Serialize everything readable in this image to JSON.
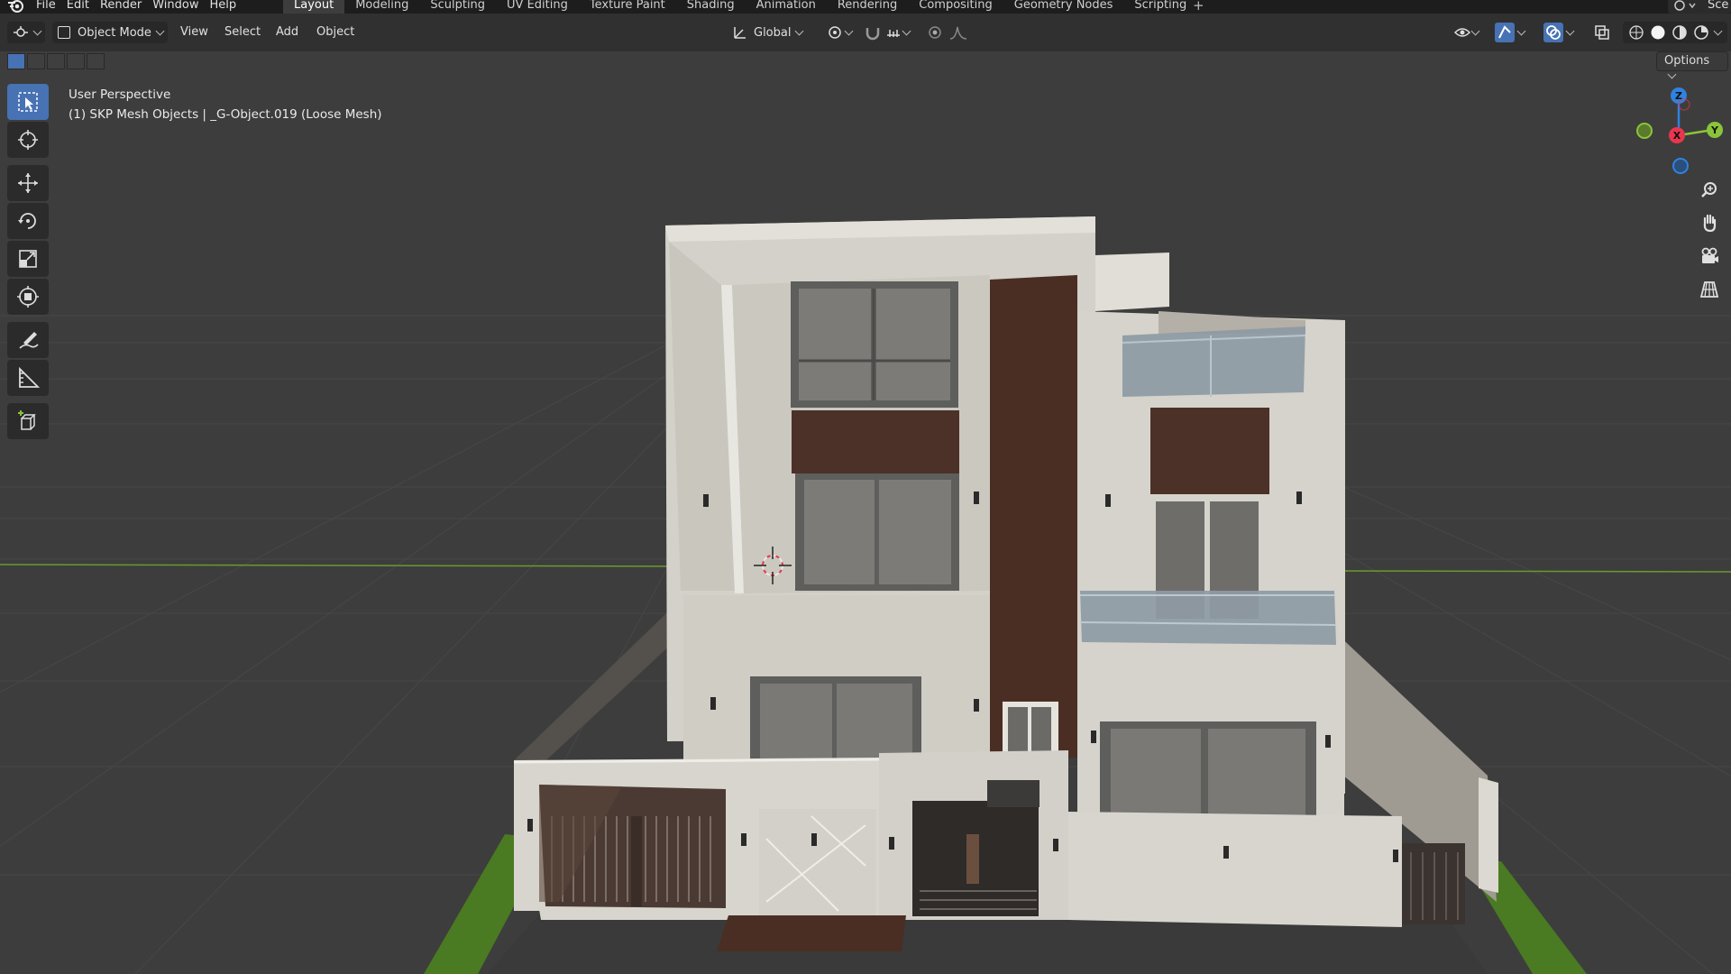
{
  "app": {
    "logo_icon": "blender-logo-icon",
    "accent": "#4772b3"
  },
  "menubar": {
    "items": [
      "File",
      "Edit",
      "Render",
      "Window",
      "Help"
    ]
  },
  "workspaces": {
    "tabs": [
      "Layout",
      "Modeling",
      "Sculpting",
      "UV Editing",
      "Texture Paint",
      "Shading",
      "Animation",
      "Rendering",
      "Compositing",
      "Geometry Nodes",
      "Scripting"
    ],
    "active": "Layout",
    "add_icon": "plus-icon",
    "scene_label": "Sce"
  },
  "header": {
    "editor_type_icon": "editor-type-icon",
    "mode_label": "Object Mode",
    "menus": [
      "View",
      "Select",
      "Add",
      "Object"
    ],
    "transform_orientation": "Global",
    "pivot_icon": "pivot-icon",
    "snap_icon": "magnet-icon",
    "proportional_icon": "proportional-edit-icon"
  },
  "subheader": {
    "options_label": "Options"
  },
  "viewport": {
    "view_name": "User Perspective",
    "object_info": "(1) SKP Mesh Objects | _G-Object.019 (Loose Mesh)",
    "gizmo": {
      "z": "Z",
      "y": "Y",
      "x": "X"
    },
    "x_axis_color": "#e8364e",
    "y_axis_color": "#8ac43a",
    "z_axis_color": "#2f82e0"
  },
  "toolbar": {
    "tools": [
      "select-box-icon",
      "cursor-icon",
      "move-icon",
      "rotate-icon",
      "scale-icon",
      "transform-icon",
      "annotate-icon",
      "measure-icon",
      "add-cube-icon"
    ]
  },
  "navigation": {
    "buttons": [
      "zoom-icon",
      "pan-hand-icon",
      "camera-icon",
      "ortho-grid-icon"
    ]
  }
}
